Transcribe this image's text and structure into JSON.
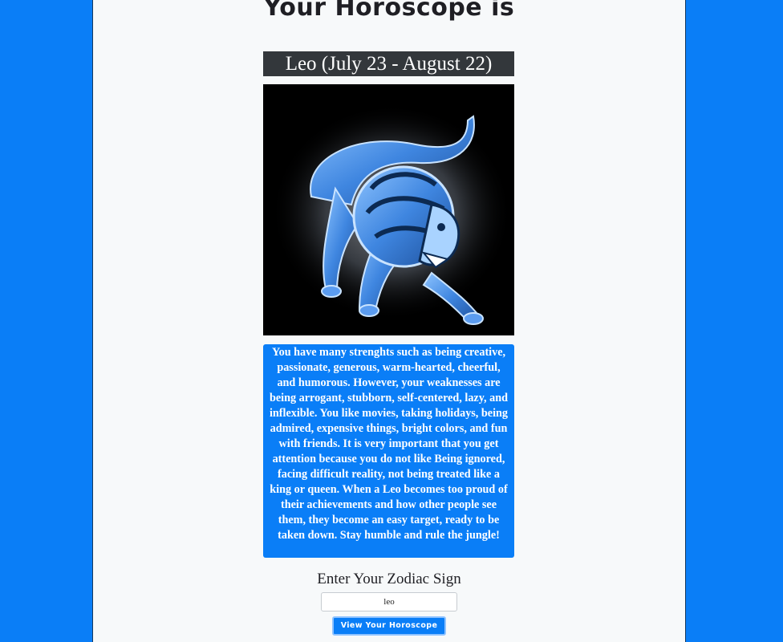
{
  "page": {
    "heading": "Your Horoscope is"
  },
  "result": {
    "sign_title": "Leo (July 23 - August 22)",
    "image_subject": "leo-lion-zodiac-icon",
    "description": "You have many strenghts such as being creative, passionate, generous, warm-hearted, cheerful, and humorous. However, your weaknesses are being arrogant, stubborn, self-centered, lazy, and inflexible. You like movies, taking holidays, being admired, expensive things, bright colors, and fun with friends. It is very important that you get attention because you do not like Being ignored, facing difficult reality, not being treated like a king or queen. When a Leo becomes too proud of their achievements and how other people see them, they become an easy target, ready to be taken down. Stay humble and rule the jungle!"
  },
  "form": {
    "label": "Enter Your Zodiac Sign",
    "input_value": "leo",
    "button_label": "View Your Horoscope"
  },
  "colors": {
    "background": "#0a7ef7",
    "panel": "#f7f9fa",
    "title_bar": "#33373b",
    "description_box": "#0a7ef7"
  }
}
